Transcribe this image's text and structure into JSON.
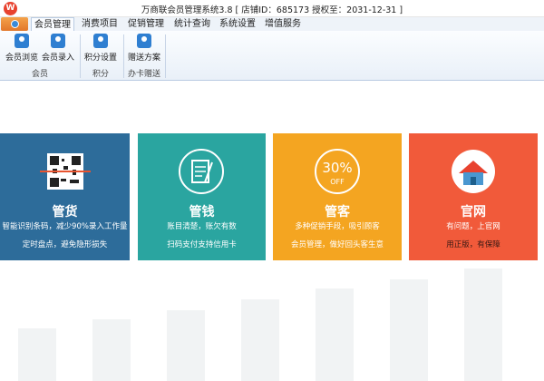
{
  "window": {
    "title": "万商联会员管理系统3.8 [ 店铺ID：685173 授权至：2031-12-31 ]"
  },
  "tabs": [
    {
      "label": "会员管理",
      "active": true
    },
    {
      "label": "消费项目"
    },
    {
      "label": "促销管理"
    },
    {
      "label": "统计查询"
    },
    {
      "label": "系统设置"
    },
    {
      "label": "增值服务"
    }
  ],
  "ribbon": {
    "buttons": [
      {
        "label": "会员浏览",
        "icon": "members-icon"
      },
      {
        "label": "会员录入",
        "icon": "add-member-icon"
      },
      {
        "label": "积分设置",
        "icon": "points-icon"
      },
      {
        "label": "赠送方案",
        "icon": "gift-plan-icon"
      }
    ],
    "groups": [
      "会员",
      "积分",
      "办卡赠送"
    ]
  },
  "cards": [
    {
      "title": "管货",
      "line1": "智能识别条码，减少90%录入工作量",
      "line2": "定时盘点，避免隐形损失",
      "color": "#2d6c9a",
      "icon": "barcode-icon"
    },
    {
      "title": "管钱",
      "line1": "账目清楚，账欠有数",
      "line2": "扫码支付支持信用卡",
      "color": "#2aa5a0",
      "icon": "ledger-icon"
    },
    {
      "title": "管客",
      "line1": "多种促销手段，吸引顾客",
      "line2": "会员管理，做好回头客生意",
      "color": "#f4a521",
      "icon": "discount-icon",
      "badge": "30%",
      "badge_sub": "OFF"
    },
    {
      "title": "官网",
      "line1": "有问题，上官网",
      "line2": "用正版，有保障",
      "color": "#f15a3a",
      "icon": "home-icon"
    }
  ]
}
